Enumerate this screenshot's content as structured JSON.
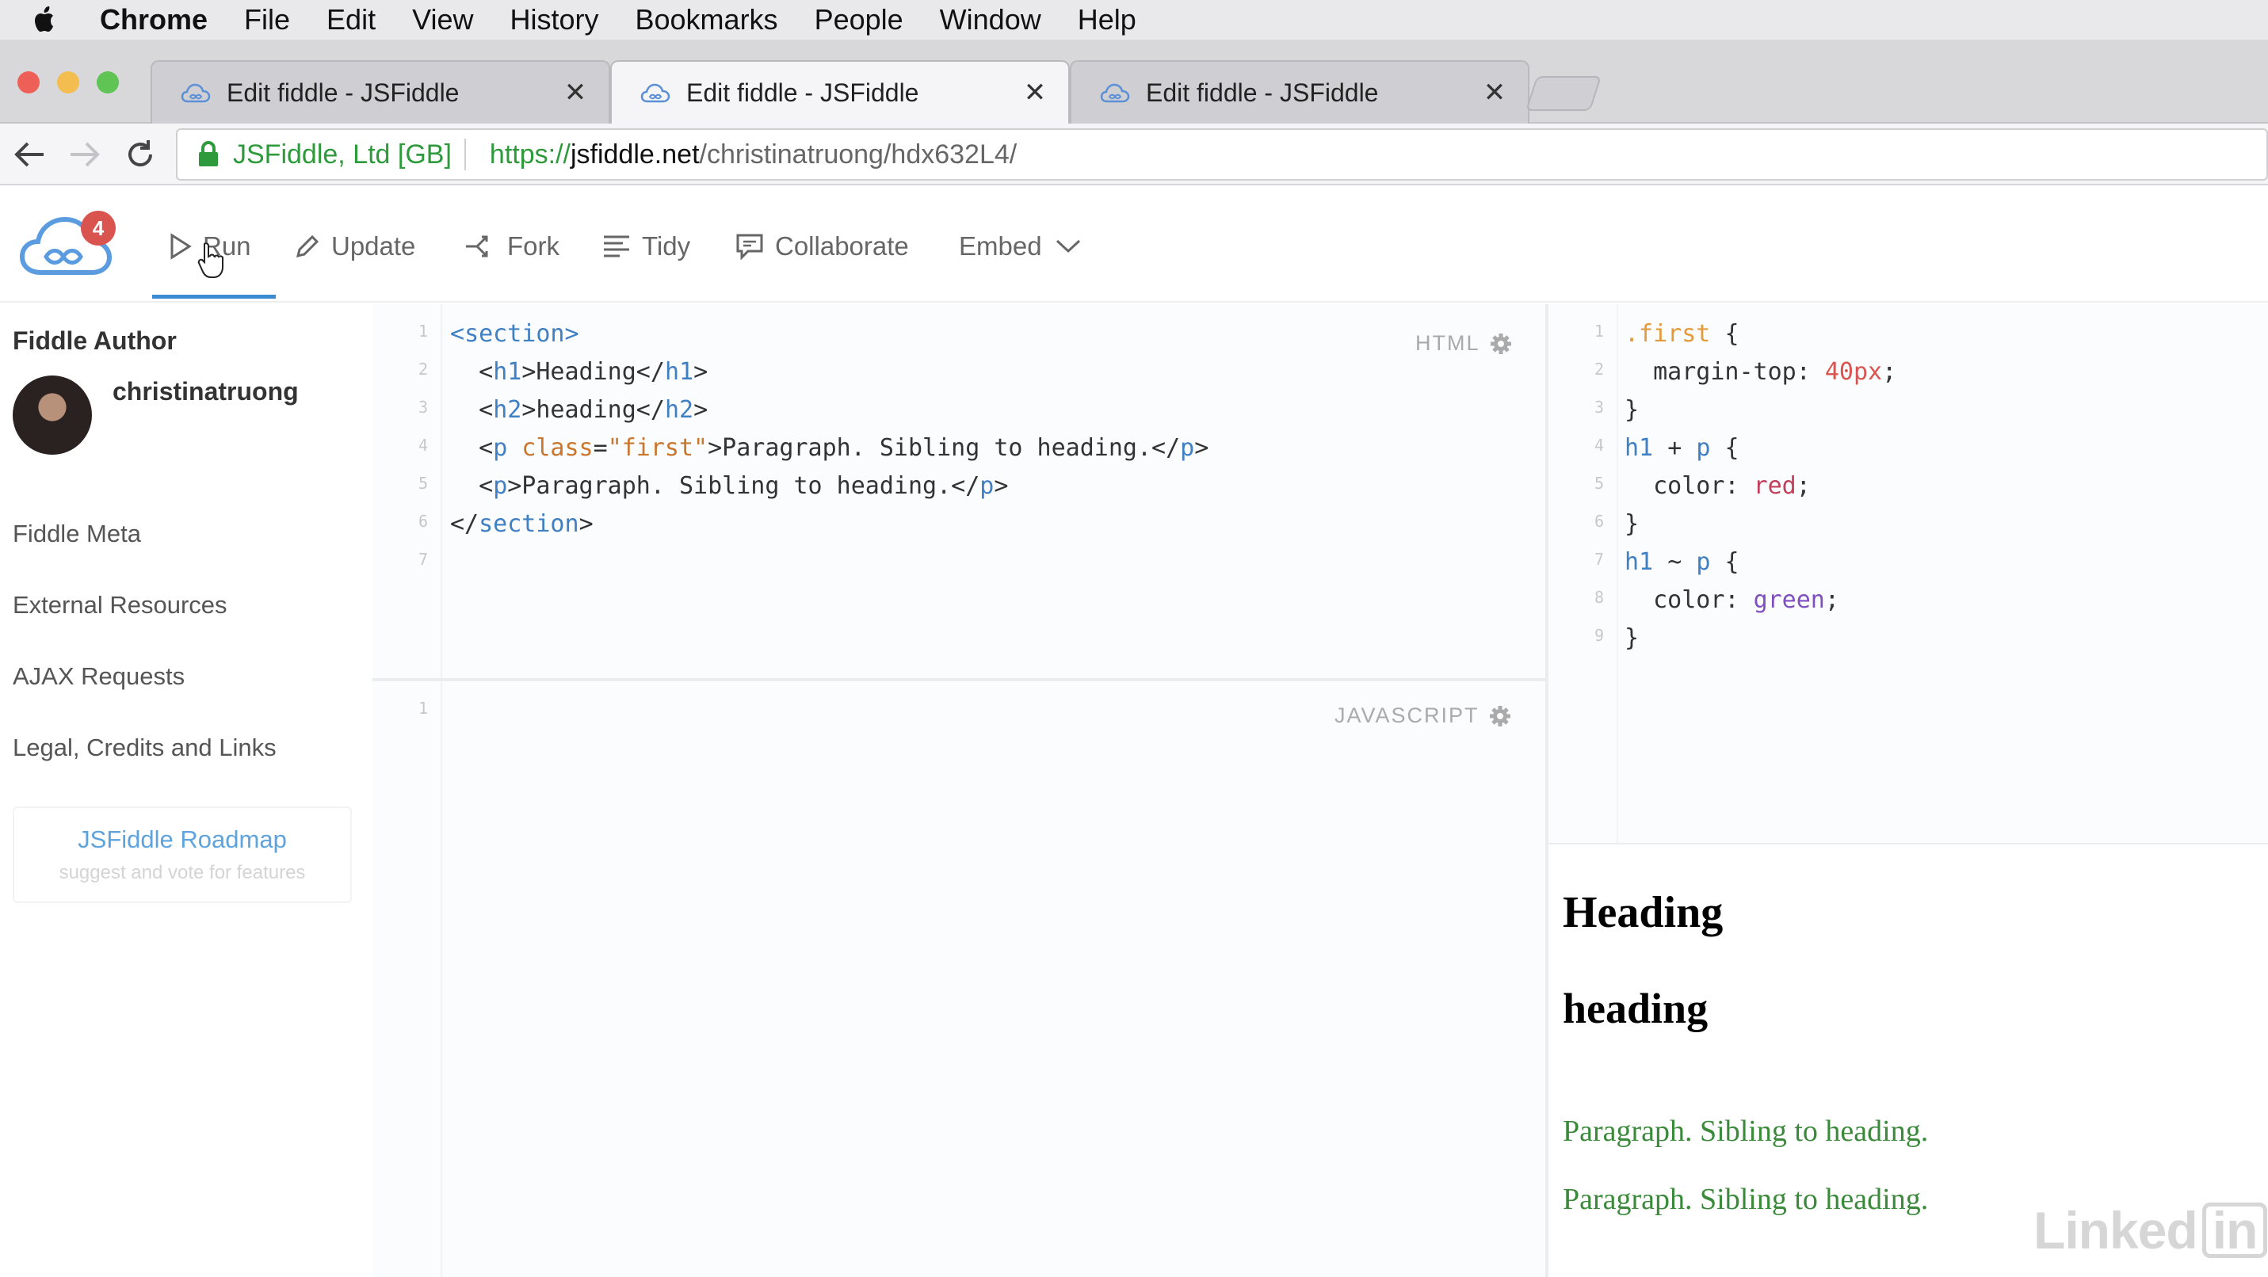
{
  "menubar": {
    "items": [
      "Chrome",
      "File",
      "Edit",
      "View",
      "History",
      "Bookmarks",
      "People",
      "Window",
      "Help"
    ]
  },
  "tabs": [
    {
      "title": "Edit fiddle - JSFiddle",
      "active": false
    },
    {
      "title": "Edit fiddle - JSFiddle",
      "active": true
    },
    {
      "title": "Edit fiddle - JSFiddle",
      "active": false
    }
  ],
  "address": {
    "cert": "JSFiddle, Ltd [GB]",
    "scheme": "https://",
    "host": "jsfiddle.net",
    "path": "/christinatruong/hdx632L4/"
  },
  "header": {
    "badge": "4",
    "run": "Run",
    "update": "Update",
    "fork": "Fork",
    "tidy": "Tidy",
    "collaborate": "Collaborate",
    "embed": "Embed"
  },
  "sidebar": {
    "author_title": "Fiddle Author",
    "username": "christinatruong",
    "links": [
      "Fiddle Meta",
      "External Resources",
      "AJAX Requests",
      "Legal, Credits and Links"
    ],
    "roadmap_title": "JSFiddle Roadmap",
    "roadmap_sub": "suggest and vote for features"
  },
  "html_pane": {
    "label": "HTML",
    "line_numbers": [
      "1",
      "2",
      "3",
      "4",
      "5",
      "6",
      "7"
    ]
  },
  "js_pane": {
    "label": "JAVASCRIPT",
    "line_numbers": [
      "1"
    ]
  },
  "css_pane": {
    "line_numbers": [
      "1",
      "2",
      "3",
      "4",
      "5",
      "6",
      "7",
      "8",
      "9"
    ]
  },
  "result": {
    "h1": "Heading",
    "h2": "heading",
    "p1": "Paragraph. Sibling to heading.",
    "p2": "Paragraph. Sibling to heading."
  },
  "watermark": {
    "text": "Linked",
    "box": "in"
  },
  "colors": {
    "accent_blue": "#3a8bd1",
    "secure_green": "#2e9a3c",
    "badge_red": "#d9534f",
    "result_green": "#3b8a3b"
  }
}
